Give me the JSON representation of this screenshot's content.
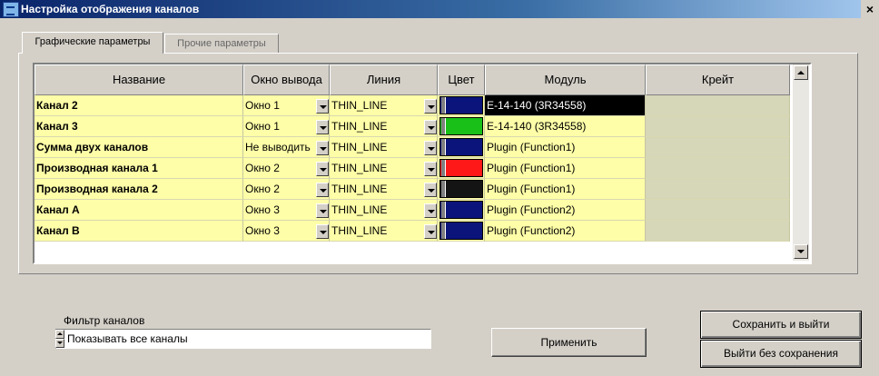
{
  "window": {
    "title": "Настройка отображения каналов",
    "close": "×"
  },
  "tabs": [
    {
      "label": "Графические параметры",
      "active": true
    },
    {
      "label": "Прочие параметры",
      "active": false
    }
  ],
  "table": {
    "columns": [
      "Название",
      "Окно вывода",
      "Линия",
      "Цвет",
      "Модуль",
      "Крейт"
    ],
    "rows": [
      {
        "name": "Канал 2",
        "window": "Окно 1",
        "line": "THIN_LINE",
        "color": "#0b147a",
        "module": "E-14-140 (3R34558)",
        "crate": "",
        "selected": true
      },
      {
        "name": "Канал 3",
        "window": "Окно 1",
        "line": "THIN_LINE",
        "color": "#18c018",
        "module": "E-14-140 (3R34558)",
        "crate": ""
      },
      {
        "name": "Сумма двух каналов",
        "window": "Не выводить",
        "line": "THIN_LINE",
        "color": "#0b147a",
        "module": "Plugin (Function1)",
        "crate": ""
      },
      {
        "name": "Производная канала 1",
        "window": "Окно 2",
        "line": "THIN_LINE",
        "color": "#ff1818",
        "module": "Plugin (Function1)",
        "crate": ""
      },
      {
        "name": "Производная канала 2",
        "window": "Окно 2",
        "line": "THIN_LINE",
        "color": "#141414",
        "module": "Plugin (Function1)",
        "crate": ""
      },
      {
        "name": "Канал А",
        "window": "Окно 3",
        "line": "THIN_LINE",
        "color": "#0b147a",
        "module": "Plugin (Function2)",
        "crate": ""
      },
      {
        "name": "Канал В",
        "window": "Окно 3",
        "line": "THIN_LINE",
        "color": "#0b147a",
        "module": "Plugin (Function2)",
        "crate": ""
      }
    ]
  },
  "filter": {
    "label": "Фильтр каналов",
    "value": "Показывать все каналы"
  },
  "buttons": {
    "apply": "Применить",
    "save_exit": "Сохранить и выйти",
    "exit_no_save": "Выйти без сохранения"
  },
  "colors": {
    "cell_bg": "#fefea8",
    "crate_bg": "#d6d6b8",
    "window_bg": "#d4d0c8"
  }
}
